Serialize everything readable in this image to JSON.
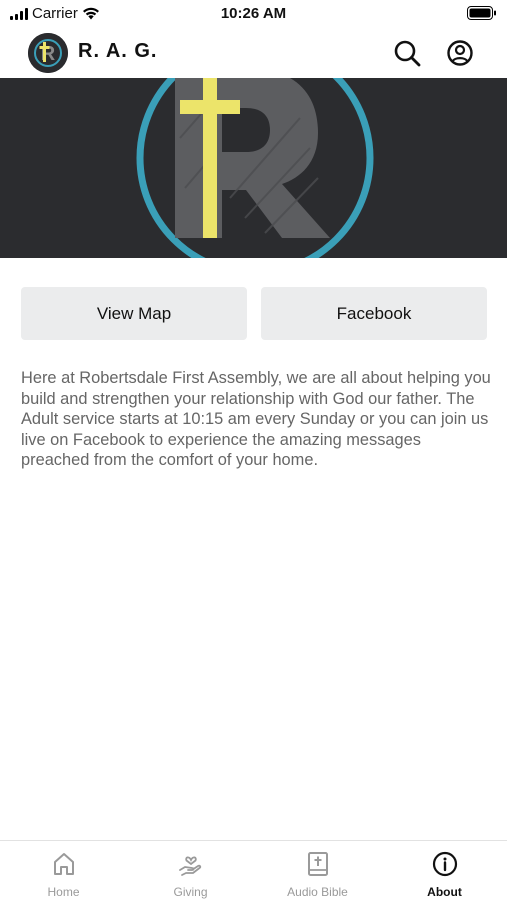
{
  "status_bar": {
    "carrier": "Carrier",
    "time": "10:26 AM"
  },
  "header": {
    "title": "R. A. G.",
    "logo_letter": "R"
  },
  "buttons": {
    "view_map": "View Map",
    "facebook": "Facebook"
  },
  "about": {
    "text": "Here at Robertsdale First Assembly, we are all about helping you build and strengthen your relationship with God our father. The Adult service starts at 10:15 am every Sunday or you can join us live on Facebook to experience the amazing messages preached from the comfort of your home."
  },
  "nav": {
    "items": [
      {
        "label": "Home",
        "icon": "home-icon"
      },
      {
        "label": "Giving",
        "icon": "giving-hand-heart-icon"
      },
      {
        "label": "Audio Bible",
        "icon": "bible-icon"
      },
      {
        "label": "About",
        "icon": "info-icon"
      }
    ],
    "active_label": "About"
  },
  "colors": {
    "hero_background": "#2b2c2f",
    "cross_yellow": "#ece46a",
    "ring_teal": "#3a9fb8",
    "button_background": "#ebeced",
    "body_text": "#666666",
    "inactive_nav": "#9a9a9a"
  }
}
